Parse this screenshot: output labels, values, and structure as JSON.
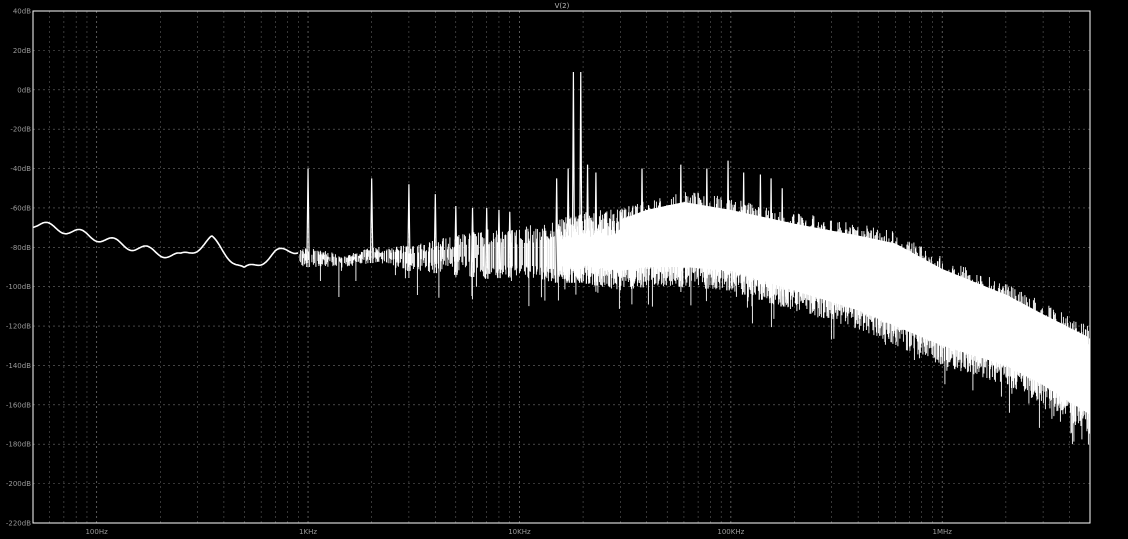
{
  "chart_data": {
    "type": "line",
    "title": "V(2)",
    "xlabel": "",
    "ylabel": "",
    "x_scale": "log",
    "x_unit": "Hz",
    "xlim": [
      50,
      5000000
    ],
    "ylim": [
      -220,
      40
    ],
    "grid": true,
    "colors": {
      "background": "#000000",
      "trace": "#ffffff",
      "grid": "#6e6e6e",
      "frame": "#ffffff",
      "text": "#a8a8a8"
    },
    "x_ticks": [
      {
        "value": 100,
        "label": "100Hz"
      },
      {
        "value": 1000,
        "label": "1KHz"
      },
      {
        "value": 10000,
        "label": "10KHz"
      },
      {
        "value": 100000,
        "label": "100KHz"
      },
      {
        "value": 1000000,
        "label": "1MHz"
      }
    ],
    "y_ticks": [
      {
        "value": 40,
        "label": "40dB"
      },
      {
        "value": 20,
        "label": "20dB"
      },
      {
        "value": 0,
        "label": "0dB"
      },
      {
        "value": -20,
        "label": "-20dB"
      },
      {
        "value": -40,
        "label": "-40dB"
      },
      {
        "value": -60,
        "label": "-60dB"
      },
      {
        "value": -80,
        "label": "-80dB"
      },
      {
        "value": -100,
        "label": "-100dB"
      },
      {
        "value": -120,
        "label": "-120dB"
      },
      {
        "value": -140,
        "label": "-140dB"
      },
      {
        "value": -160,
        "label": "-160dB"
      },
      {
        "value": -180,
        "label": "-180dB"
      },
      {
        "value": -200,
        "label": "-200dB"
      },
      {
        "value": -220,
        "label": "-220dB"
      }
    ],
    "series": [
      {
        "description": "spectrum envelope (upper edge / lower edge of the dense trace)",
        "x": [
          50,
          70,
          100,
          150,
          250,
          350,
          500,
          700,
          1000,
          1500,
          2000,
          3000,
          5000,
          7000,
          10000,
          15000,
          20000,
          30000,
          40000,
          60000,
          100000,
          200000,
          400000,
          600000,
          1000000,
          2000000,
          3000000,
          5000000
        ],
        "upper": [
          -68,
          -71,
          -75,
          -80,
          -85,
          -76,
          -92,
          -83,
          -80,
          -84,
          -80,
          -79,
          -74,
          -71,
          -70,
          -65,
          -62,
          -60,
          -55,
          -51,
          -55,
          -62,
          -68,
          -72,
          -85,
          -98,
          -108,
          -120
        ],
        "lower": [
          -68,
          -71,
          -75,
          -80,
          -85,
          -78,
          -95,
          -92,
          -90,
          -90,
          -88,
          -92,
          -94,
          -96,
          -95,
          -98,
          -98,
          -102,
          -100,
          -100,
          -102,
          -112,
          -122,
          -130,
          -140,
          -150,
          -160,
          -175
        ]
      }
    ],
    "peaks": [
      {
        "x": 1000,
        "y": -40
      },
      {
        "x": 2000,
        "y": -45
      },
      {
        "x": 3000,
        "y": -48
      },
      {
        "x": 4000,
        "y": -53
      },
      {
        "x": 5000,
        "y": -59
      },
      {
        "x": 6000,
        "y": -60
      },
      {
        "x": 7000,
        "y": -60
      },
      {
        "x": 8000,
        "y": -61
      },
      {
        "x": 9000,
        "y": -62
      },
      {
        "x": 18000,
        "y": 9
      },
      {
        "x": 19500,
        "y": 9
      },
      {
        "x": 17000,
        "y": -40
      },
      {
        "x": 21000,
        "y": -38
      },
      {
        "x": 15000,
        "y": -45
      },
      {
        "x": 23000,
        "y": -42
      },
      {
        "x": 38000,
        "y": -40
      },
      {
        "x": 58000,
        "y": -38
      },
      {
        "x": 77000,
        "y": -40
      },
      {
        "x": 97000,
        "y": -36
      },
      {
        "x": 115000,
        "y": -42
      },
      {
        "x": 138000,
        "y": -43
      },
      {
        "x": 155000,
        "y": -45
      },
      {
        "x": 175000,
        "y": -50
      }
    ]
  }
}
